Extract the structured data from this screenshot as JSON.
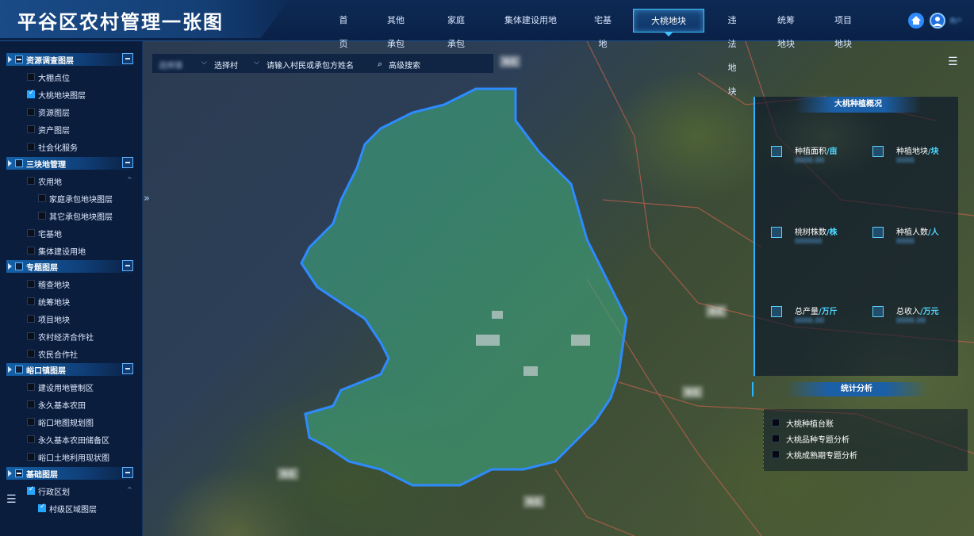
{
  "app": {
    "title": "平谷区农村管理一张图"
  },
  "nav": {
    "items": [
      {
        "label": "首页",
        "active": false
      },
      {
        "label": "其他承包",
        "active": false
      },
      {
        "label": "家庭承包",
        "active": false
      },
      {
        "label": "集体建设用地",
        "active": false
      },
      {
        "label": "宅基地",
        "active": false
      },
      {
        "label": "大桃地块",
        "active": true
      },
      {
        "label": "违法地块",
        "active": false
      },
      {
        "label": "统筹地块",
        "active": false
      },
      {
        "label": "项目地块",
        "active": false
      }
    ],
    "icons": [
      "home-icon",
      "user-icon"
    ]
  },
  "sidebar": {
    "groups": [
      {
        "label": "资源调查图层",
        "items": [
          {
            "label": "大棚点位",
            "checked": false
          },
          {
            "label": "大桃地块图层",
            "checked": true
          },
          {
            "label": "资源图层",
            "checked": false
          },
          {
            "label": "资产图层",
            "checked": false
          },
          {
            "label": "社会化服务",
            "checked": false
          }
        ]
      },
      {
        "label": "三块地管理",
        "items": [
          {
            "label": "农用地",
            "checked": false
          },
          {
            "label": "家庭承包地块图层",
            "checked": false
          },
          {
            "label": "其它承包地块图层",
            "checked": false
          },
          {
            "label": "宅基地",
            "checked": false
          },
          {
            "label": "集体建设用地",
            "checked": false
          }
        ]
      },
      {
        "label": "专题图层",
        "items": [
          {
            "label": "稽查地块",
            "checked": false
          },
          {
            "label": "统筹地块",
            "checked": false
          },
          {
            "label": "项目地块",
            "checked": false
          },
          {
            "label": "农村经济合作社",
            "checked": false
          },
          {
            "label": "农民合作社",
            "checked": false
          }
        ]
      },
      {
        "label": "峪口镇图层",
        "items": [
          {
            "label": "建设用地管制区",
            "checked": false
          },
          {
            "label": "永久基本农田",
            "checked": false
          },
          {
            "label": "峪口地图规划图",
            "checked": false
          },
          {
            "label": "永久基本农田储备区",
            "checked": false
          },
          {
            "label": "峪口土地利用现状图",
            "checked": false
          }
        ]
      },
      {
        "label": "基础图层",
        "items": [
          {
            "label": "行政区划",
            "checked": false
          },
          {
            "label": "村级区域图层",
            "checked": true
          }
        ]
      }
    ]
  },
  "search": {
    "town_select": "选择镇",
    "village_select": "选择村",
    "keyword_placeholder": "请输入村民或承包方姓名",
    "advanced_label": "高级搜索"
  },
  "stats_panel": {
    "title": "大桃种植概况",
    "items": [
      {
        "label": "种植面积",
        "unit": "/亩",
        "icon": "area-icon"
      },
      {
        "label": "种植地块",
        "unit": "/块",
        "icon": "plot-icon"
      },
      {
        "label": "桃树株数",
        "unit": "/株",
        "icon": "tree-icon"
      },
      {
        "label": "种植人数",
        "unit": "/人",
        "icon": "people-icon"
      },
      {
        "label": "总产量",
        "unit": "/万斤",
        "icon": "yield-icon"
      },
      {
        "label": "总收入",
        "unit": "/万元",
        "icon": "income-icon"
      }
    ]
  },
  "analysis_panel": {
    "title": "统计分析",
    "items": [
      {
        "label": "大桃种植台账"
      },
      {
        "label": "大桃品种专题分析"
      },
      {
        "label": "大桃成熟期专题分析"
      }
    ]
  },
  "colors": {
    "accent": "#28b7ff",
    "header_bg": "#0d2a55",
    "sidebar_bg": "#0b1d3d",
    "boundary": "#2e8bff",
    "region_fill": "#3ea07a"
  }
}
